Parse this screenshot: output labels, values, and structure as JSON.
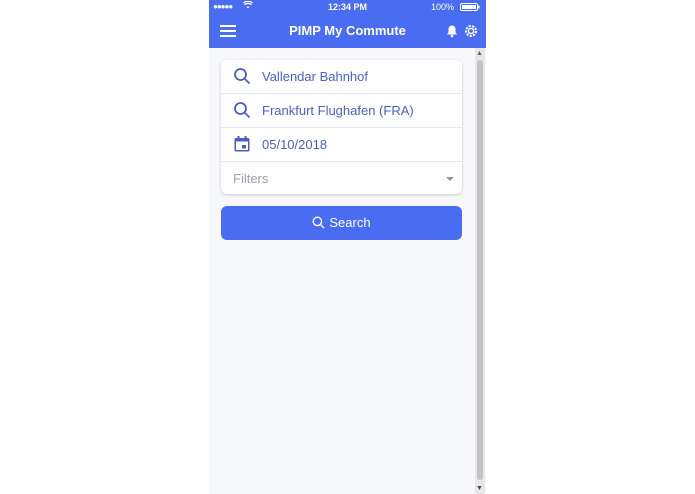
{
  "status_bar": {
    "signal": "●●●●●",
    "time": "12:34 PM",
    "battery": "100%"
  },
  "app_bar": {
    "title": "PIMP My Commute",
    "menu_icon": "hamburger-menu-icon",
    "notification_icon": "bell-icon",
    "settings_icon": "settings-icon"
  },
  "form": {
    "from": "Vallendar Bahnhof",
    "to": "Frankfurt Flughafen (FRA)",
    "date": "05/10/2018",
    "filters_placeholder": "Filters"
  },
  "search_button": {
    "label": "Search"
  },
  "colors": {
    "primary": "#4a6cf0",
    "input_text": "#4a5fc1",
    "background": "#f7f8fb"
  }
}
